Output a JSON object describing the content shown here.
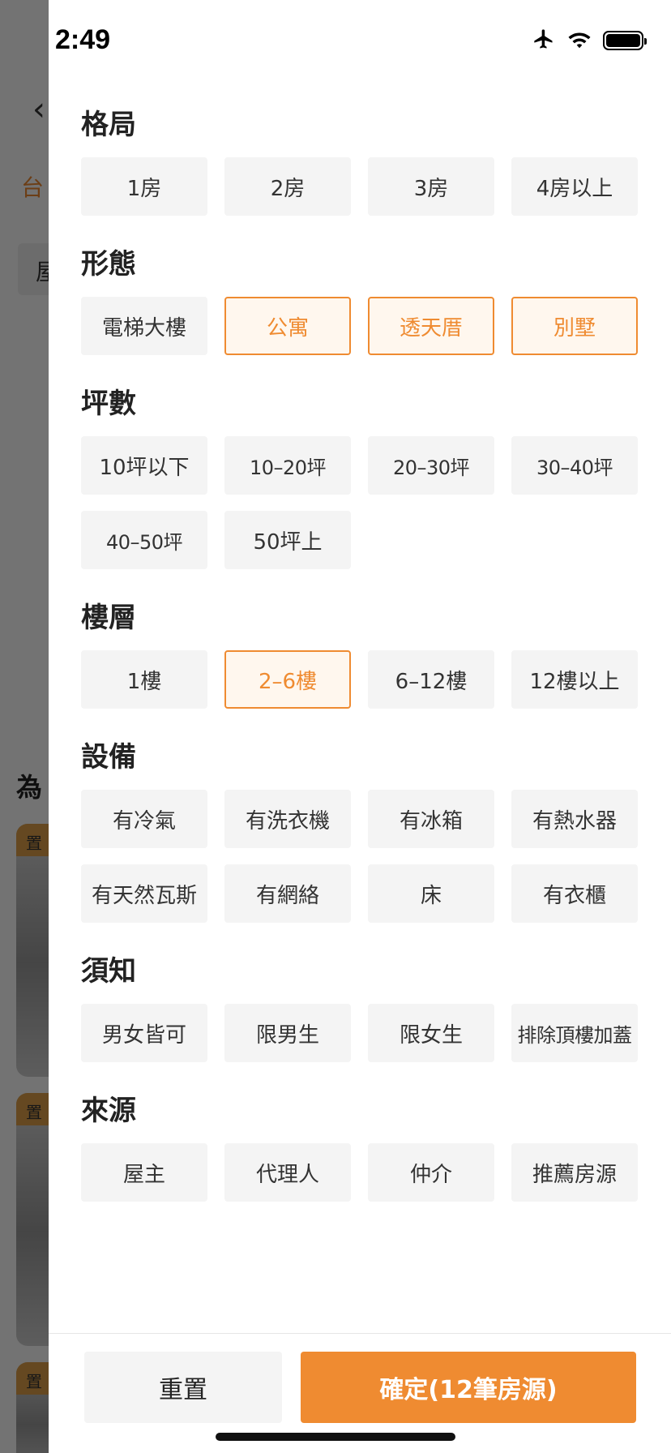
{
  "status_bar": {
    "time": "2:49"
  },
  "background": {
    "back_glyph": "‹",
    "city_text": "台",
    "chip_text": "屋",
    "heading": "為",
    "card_tags": [
      "置",
      "置",
      "置"
    ]
  },
  "sections": [
    {
      "title": "格局",
      "options": [
        {
          "label": "1房",
          "selected": false
        },
        {
          "label": "2房",
          "selected": false
        },
        {
          "label": "3房",
          "selected": false
        },
        {
          "label": "4房以上",
          "selected": false
        }
      ]
    },
    {
      "title": "形態",
      "options": [
        {
          "label": "電梯大樓",
          "selected": false
        },
        {
          "label": "公寓",
          "selected": true
        },
        {
          "label": "透天厝",
          "selected": true
        },
        {
          "label": "別墅",
          "selected": true
        }
      ]
    },
    {
      "title": "坪數",
      "options": [
        {
          "label": "10坪以下",
          "selected": false
        },
        {
          "label": "10–20坪",
          "selected": false
        },
        {
          "label": "20–30坪",
          "selected": false
        },
        {
          "label": "30–40坪",
          "selected": false
        },
        {
          "label": "40–50坪",
          "selected": false
        },
        {
          "label": "50坪上",
          "selected": false
        }
      ]
    },
    {
      "title": "樓層",
      "options": [
        {
          "label": "1樓",
          "selected": false
        },
        {
          "label": "2–6樓",
          "selected": true
        },
        {
          "label": "6–12樓",
          "selected": false
        },
        {
          "label": "12樓以上",
          "selected": false
        }
      ]
    },
    {
      "title": "設備",
      "options": [
        {
          "label": "有冷氣",
          "selected": false
        },
        {
          "label": "有洗衣機",
          "selected": false
        },
        {
          "label": "有冰箱",
          "selected": false
        },
        {
          "label": "有熱水器",
          "selected": false
        },
        {
          "label": "有天然瓦斯",
          "selected": false
        },
        {
          "label": "有網絡",
          "selected": false
        },
        {
          "label": "床",
          "selected": false
        },
        {
          "label": "有衣櫃",
          "selected": false
        }
      ]
    },
    {
      "title": "須知",
      "options": [
        {
          "label": "男女皆可",
          "selected": false
        },
        {
          "label": "限男生",
          "selected": false
        },
        {
          "label": "限女生",
          "selected": false
        },
        {
          "label": "排除頂樓加蓋",
          "selected": false
        }
      ]
    },
    {
      "title": "來源",
      "options": [
        {
          "label": "屋主",
          "selected": false
        },
        {
          "label": "代理人",
          "selected": false
        },
        {
          "label": "仲介",
          "selected": false
        },
        {
          "label": "推薦房源",
          "selected": false
        }
      ]
    }
  ],
  "footer": {
    "reset_label": "重置",
    "confirm_label": "確定(12筆房源)"
  },
  "colors": {
    "accent": "#ef8b31",
    "option_bg": "#f4f4f4",
    "selected_bg": "#fff7ee"
  },
  "icons": [
    "airplane-icon",
    "wifi-icon",
    "battery-icon"
  ]
}
